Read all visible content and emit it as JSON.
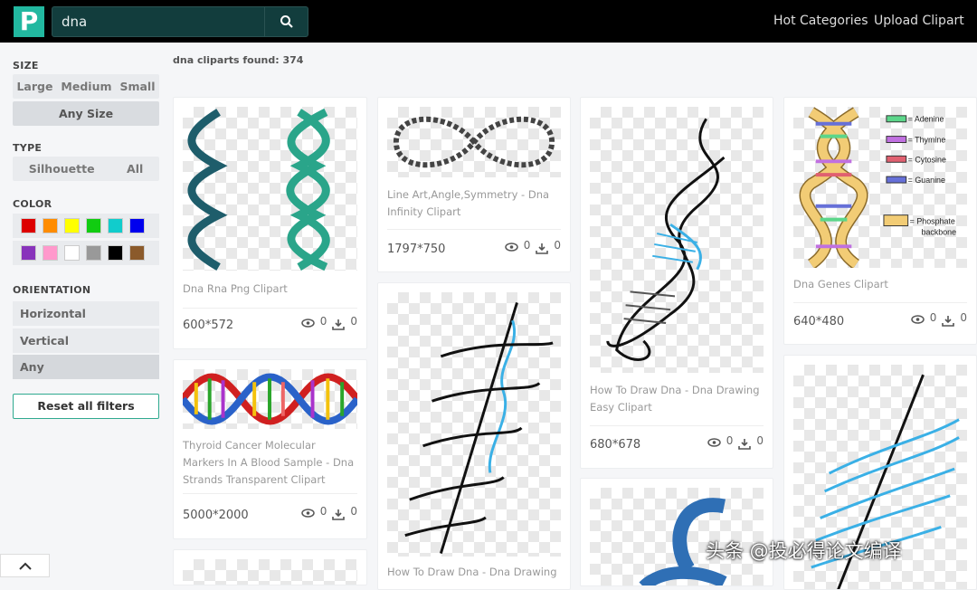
{
  "header": {
    "logo": "P",
    "search_value": "dna",
    "nav": [
      "Hot Categories",
      "Upload Clipart"
    ]
  },
  "sidebar": {
    "size": {
      "label": "SIZE",
      "options": [
        "Large",
        "Medium",
        "Small"
      ],
      "selected": "Any Size"
    },
    "type": {
      "label": "TYPE",
      "options": [
        "Silhouette",
        "All"
      ]
    },
    "color": {
      "label": "COLOR",
      "swatches": [
        "#dd0000",
        "#ff8c00",
        "#ffff00",
        "#11cc11",
        "#11cccc",
        "#0000ee",
        "#8833bb",
        "#ff99cc",
        "#ffffff",
        "#999999",
        "#000000",
        "#8b5a2b"
      ]
    },
    "orientation": {
      "label": "ORIENTATION",
      "options": [
        "Horizontal",
        "Vertical",
        "Any"
      ],
      "selected": "Any"
    },
    "reset": "Reset all filters"
  },
  "results": {
    "found": "dna cliparts found: 374"
  },
  "cards": [
    {
      "title": "Dna Rna Png Clipart",
      "dims": "600*572",
      "views": "0",
      "downloads": "0"
    },
    {
      "title": "Thyroid Cancer Molecular Markers In A Blood Sample - Dna Strands Transparent Clipart",
      "dims": "5000*2000",
      "views": "0",
      "downloads": "0"
    },
    {
      "title": "Line Art,Angle,Symmetry - Dna Infinity Clipart",
      "dims": "1797*750",
      "views": "0",
      "downloads": "0"
    },
    {
      "title": "How To Draw Dna - Dna Drawing"
    },
    {
      "title": "How To Draw Dna - Dna Drawing Easy Clipart",
      "dims": "680*678",
      "views": "0",
      "downloads": "0"
    },
    {
      "title": "Dna Genes Clipart",
      "dims": "640*480",
      "views": "0",
      "downloads": "0",
      "legend": [
        "= Adenine",
        "= Thymine",
        "= Cytosine",
        "= Guanine",
        "= Phosphate",
        "backbone"
      ]
    }
  ],
  "watermark": "头条 @投必得论文编译"
}
